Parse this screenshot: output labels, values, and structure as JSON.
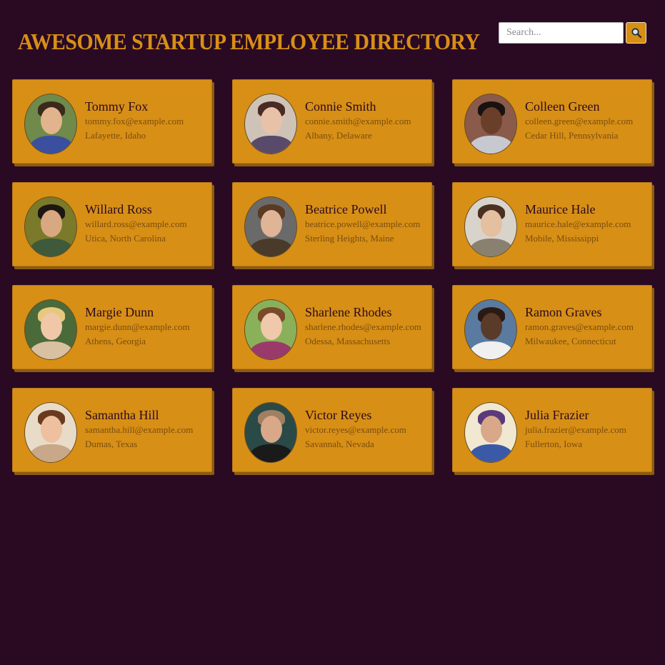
{
  "header": {
    "title": "AWESOME STARTUP EMPLOYEE DIRECTORY",
    "search_placeholder": "Search...",
    "search_icon": "magnifier-icon"
  },
  "employees": [
    {
      "name": "Tommy Fox",
      "email": "tommy.fox@example.com",
      "location": "Lafayette, Idaho",
      "photo": {
        "bg": "#6f8a4a",
        "skin": "#e2b48d",
        "hair": "#3a2a1c",
        "shirt": "#3a4fa0"
      }
    },
    {
      "name": "Connie Smith",
      "email": "connie.smith@example.com",
      "location": "Albany, Delaware",
      "photo": {
        "bg": "#cfc3b8",
        "skin": "#e7c2a8",
        "hair": "#4a2a24",
        "shirt": "#5a4a6a"
      }
    },
    {
      "name": "Colleen Green",
      "email": "colleen.green@example.com",
      "location": "Cedar Hill, Pennsylvania",
      "photo": {
        "bg": "#8a5a4a",
        "skin": "#6a3f2a",
        "hair": "#1a1210",
        "shirt": "#c8c8d0"
      }
    },
    {
      "name": "Willard Ross",
      "email": "willard.ross@example.com",
      "location": "Utica, North Carolina",
      "photo": {
        "bg": "#7a7a2a",
        "skin": "#d8a880",
        "hair": "#1e1612",
        "shirt": "#3e5a3a"
      }
    },
    {
      "name": "Beatrice Powell",
      "email": "beatrice.powell@example.com",
      "location": "Sterling Heights, Maine",
      "photo": {
        "bg": "#6a6a6a",
        "skin": "#e0b496",
        "hair": "#5a3a22",
        "shirt": "#4a3a2a"
      }
    },
    {
      "name": "Maurice Hale",
      "email": "maurice.hale@example.com",
      "location": "Mobile, Mississippi",
      "photo": {
        "bg": "#d8d4cc",
        "skin": "#e4bfa0",
        "hair": "#4a3020",
        "shirt": "#8a8070"
      }
    },
    {
      "name": "Margie Dunn",
      "email": "margie.dunn@example.com",
      "location": "Athens, Georgia",
      "photo": {
        "bg": "#4a6a3a",
        "skin": "#f0c8a8",
        "hair": "#e8c880",
        "shirt": "#d8c0a0"
      }
    },
    {
      "name": "Sharlene Rhodes",
      "email": "sharlene.rhodes@example.com",
      "location": "Odessa, Massachusetts",
      "photo": {
        "bg": "#8ab05a",
        "skin": "#f0c8ac",
        "hair": "#7a4a2a",
        "shirt": "#9a3a6a"
      }
    },
    {
      "name": "Ramon Graves",
      "email": "ramon.graves@example.com",
      "location": "Milwaukee, Connecticut",
      "photo": {
        "bg": "#5a7aa0",
        "skin": "#5a3a28",
        "hair": "#2a1a14",
        "shirt": "#f0f0f0"
      }
    },
    {
      "name": "Samantha Hill",
      "email": "samantha.hill@example.com",
      "location": "Dumas, Texas",
      "photo": {
        "bg": "#e8dcc8",
        "skin": "#eec0a0",
        "hair": "#6a3a1e",
        "shirt": "#c8a888"
      }
    },
    {
      "name": "Victor Reyes",
      "email": "victor.reyes@example.com",
      "location": "Savannah, Nevada",
      "photo": {
        "bg": "#2a4a48",
        "skin": "#d8a888",
        "hair": "#a08060",
        "shirt": "#1a1a1a"
      }
    },
    {
      "name": "Julia Frazier",
      "email": "julia.frazier@example.com",
      "location": "Fullerton, Iowa",
      "photo": {
        "bg": "#f0e8d0",
        "skin": "#d8a888",
        "hair": "#5a3a7a",
        "shirt": "#3a5aa8"
      }
    }
  ]
}
